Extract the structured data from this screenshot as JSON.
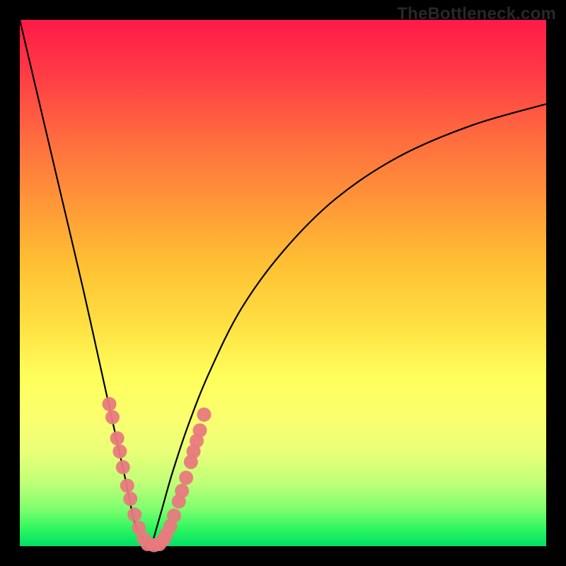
{
  "watermark": "TheBottleneck.com",
  "chart_data": {
    "type": "line",
    "title": "",
    "xlabel": "",
    "ylabel": "",
    "xlim": [
      0,
      100
    ],
    "ylim": [
      0,
      100
    ],
    "grid": false,
    "legend": false,
    "series": [
      {
        "name": "left-curve",
        "x": [
          0,
          4,
          8,
          12,
          16,
          18,
          20,
          21,
          22,
          23,
          24,
          25
        ],
        "values": [
          100,
          83,
          66,
          49,
          31,
          22,
          13,
          8,
          4,
          2,
          1,
          0
        ]
      },
      {
        "name": "right-curve",
        "x": [
          25,
          27,
          29,
          32,
          36,
          42,
          50,
          60,
          72,
          86,
          100
        ],
        "values": [
          0,
          7,
          14,
          23,
          33,
          45,
          56,
          66,
          74,
          80,
          84
        ]
      }
    ],
    "markers": {
      "name": "pink-points",
      "color": "#e87a7e",
      "points": [
        {
          "x": 17.0,
          "y": 27.0
        },
        {
          "x": 17.6,
          "y": 24.5
        },
        {
          "x": 18.5,
          "y": 20.5
        },
        {
          "x": 19.0,
          "y": 18.0
        },
        {
          "x": 19.6,
          "y": 15.0
        },
        {
          "x": 20.4,
          "y": 11.5
        },
        {
          "x": 21.0,
          "y": 9.0
        },
        {
          "x": 21.8,
          "y": 6.0
        },
        {
          "x": 22.6,
          "y": 3.5
        },
        {
          "x": 23.5,
          "y": 1.5
        },
        {
          "x": 24.3,
          "y": 0.4
        },
        {
          "x": 25.5,
          "y": 0.2
        },
        {
          "x": 26.5,
          "y": 0.4
        },
        {
          "x": 27.3,
          "y": 1.2
        },
        {
          "x": 27.8,
          "y": 2.2
        },
        {
          "x": 28.6,
          "y": 3.8
        },
        {
          "x": 29.3,
          "y": 5.8
        },
        {
          "x": 30.2,
          "y": 8.5
        },
        {
          "x": 30.8,
          "y": 10.5
        },
        {
          "x": 31.6,
          "y": 13.0
        },
        {
          "x": 32.5,
          "y": 16.0
        },
        {
          "x": 33.0,
          "y": 18.0
        },
        {
          "x": 33.6,
          "y": 20.0
        },
        {
          "x": 34.2,
          "y": 22.0
        },
        {
          "x": 35.0,
          "y": 25.0
        }
      ]
    }
  }
}
